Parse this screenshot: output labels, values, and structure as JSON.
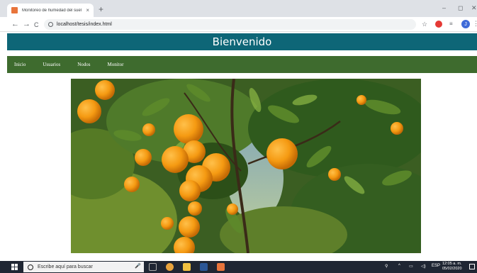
{
  "browser": {
    "tab_title": "Monitoreo de humedad del suel",
    "tab_close": "×",
    "new_tab": "+",
    "url": "localhost/tesis/index.html",
    "back": "←",
    "forward": "→",
    "reload": "C",
    "star": "☆",
    "profile_initial": "J",
    "menu": "⋮",
    "window_controls": {
      "minimize": "–",
      "maximize": "◻",
      "close": "✕"
    }
  },
  "page": {
    "title": "Bienvenido",
    "nav": [
      "Inicio",
      "Usuarios",
      "Nodos",
      "Monitor"
    ],
    "colors": {
      "header": "#0e6677",
      "navbar": "#3e6b2e"
    }
  },
  "taskbar": {
    "search_placeholder": "Escribe aquí para buscar",
    "language": "ESP",
    "time": "12:05 a. m.",
    "date": "05/02/2020"
  }
}
